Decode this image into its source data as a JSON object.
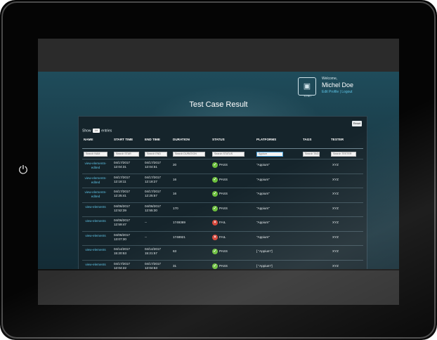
{
  "header": {
    "logo_caption": "STMT",
    "welcome": "Welcome,",
    "user_name": "Michel Doe",
    "links": "Edit Profile | Logout"
  },
  "page_title": "Test Case Result",
  "panel": {
    "top_button": "Reset",
    "show_label": "Show",
    "entries_value": "10",
    "entries_label": "entries"
  },
  "columns": [
    "NAME",
    "START TIME",
    "END TIME",
    "DURATION",
    "STATUS",
    "PLATFORMS",
    "TAGS",
    "TESTER"
  ],
  "filters": [
    {
      "placeholder": "Search NAM",
      "value": ""
    },
    {
      "placeholder": "Search STAR",
      "value": ""
    },
    {
      "placeholder": "Search END",
      "value": ""
    },
    {
      "placeholder": "Search DURATION",
      "value": ""
    },
    {
      "placeholder": "Search STATUS",
      "value": ""
    },
    {
      "placeholder": "",
      "value": "Appium"
    },
    {
      "placeholder": "Search TAGS",
      "value": ""
    },
    {
      "placeholder": "Search TESTER",
      "value": ""
    }
  ],
  "rows": [
    {
      "name": "view-elements-edited",
      "start_date": "04/17/2017",
      "start_time": "12:04:31",
      "end_date": "04/17/2017",
      "end_time": "12:04:51",
      "duration": "20",
      "status": "PASS",
      "platforms": "\"Appium\"",
      "tags": "",
      "tester": "XYZ"
    },
    {
      "name": "view-elements-edited",
      "start_date": "04/17/2017",
      "start_time": "12:18:11",
      "end_date": "04/17/2017",
      "end_time": "12:18:27",
      "duration": "16",
      "status": "PASS",
      "platforms": "\"Appium\"",
      "tags": "",
      "tester": "XYZ"
    },
    {
      "name": "view-elements-edited",
      "start_date": "04/17/2017",
      "start_time": "12:25:41",
      "end_date": "04/17/2017",
      "end_time": "12:25:57",
      "duration": "16",
      "status": "PASS",
      "platforms": "\"Appium\"",
      "tags": "",
      "tester": "XYZ"
    },
    {
      "name": "view-elements",
      "start_date": "04/06/2017",
      "start_time": "12:52:39",
      "end_date": "04/06/2017",
      "end_time": "12:55:30",
      "duration": "170",
      "status": "PASS",
      "platforms": "\"Appium\"",
      "tags": "",
      "tester": "XYZ"
    },
    {
      "name": "view-elements",
      "start_date": "04/06/2017",
      "start_time": "12:59:47",
      "end_date": "",
      "end_time": "--",
      "duration": "1749369",
      "status": "FAIL",
      "platforms": "\"Appium\"",
      "tags": "",
      "tester": "XYZ"
    },
    {
      "name": "view-elements",
      "start_date": "04/06/2017",
      "start_time": "13:07:30",
      "end_date": "",
      "end_time": "--",
      "duration": "1748921",
      "status": "FAIL",
      "platforms": "\"Appium\"",
      "tags": "",
      "tester": "XYZ"
    },
    {
      "name": "view-elements",
      "start_date": "04/14/2017",
      "start_time": "15:20:53",
      "end_date": "04/14/2017",
      "end_time": "15:21:57",
      "duration": "63",
      "status": "PASS",
      "platforms": "[ \"Appium\"]",
      "tags": "",
      "tester": "XYZ"
    },
    {
      "name": "view-elements",
      "start_date": "04/17/2017",
      "start_time": "12:04:22",
      "end_date": "04/17/2017",
      "end_time": "12:04:53",
      "duration": "31",
      "status": "PASS",
      "platforms": "[ \"Appium\"]",
      "tags": "",
      "tester": "XYZ"
    }
  ],
  "colors": {
    "app_bg": "#1f4c5b",
    "panel_bg": "#15242b",
    "link": "#5fc4e6",
    "pass": "#6cbf3c",
    "fail": "#d44437"
  },
  "icons": {
    "home_button": "power-icon",
    "logo": "monitor-logo-icon",
    "pass": "check-circle-icon",
    "fail": "x-circle-icon"
  }
}
